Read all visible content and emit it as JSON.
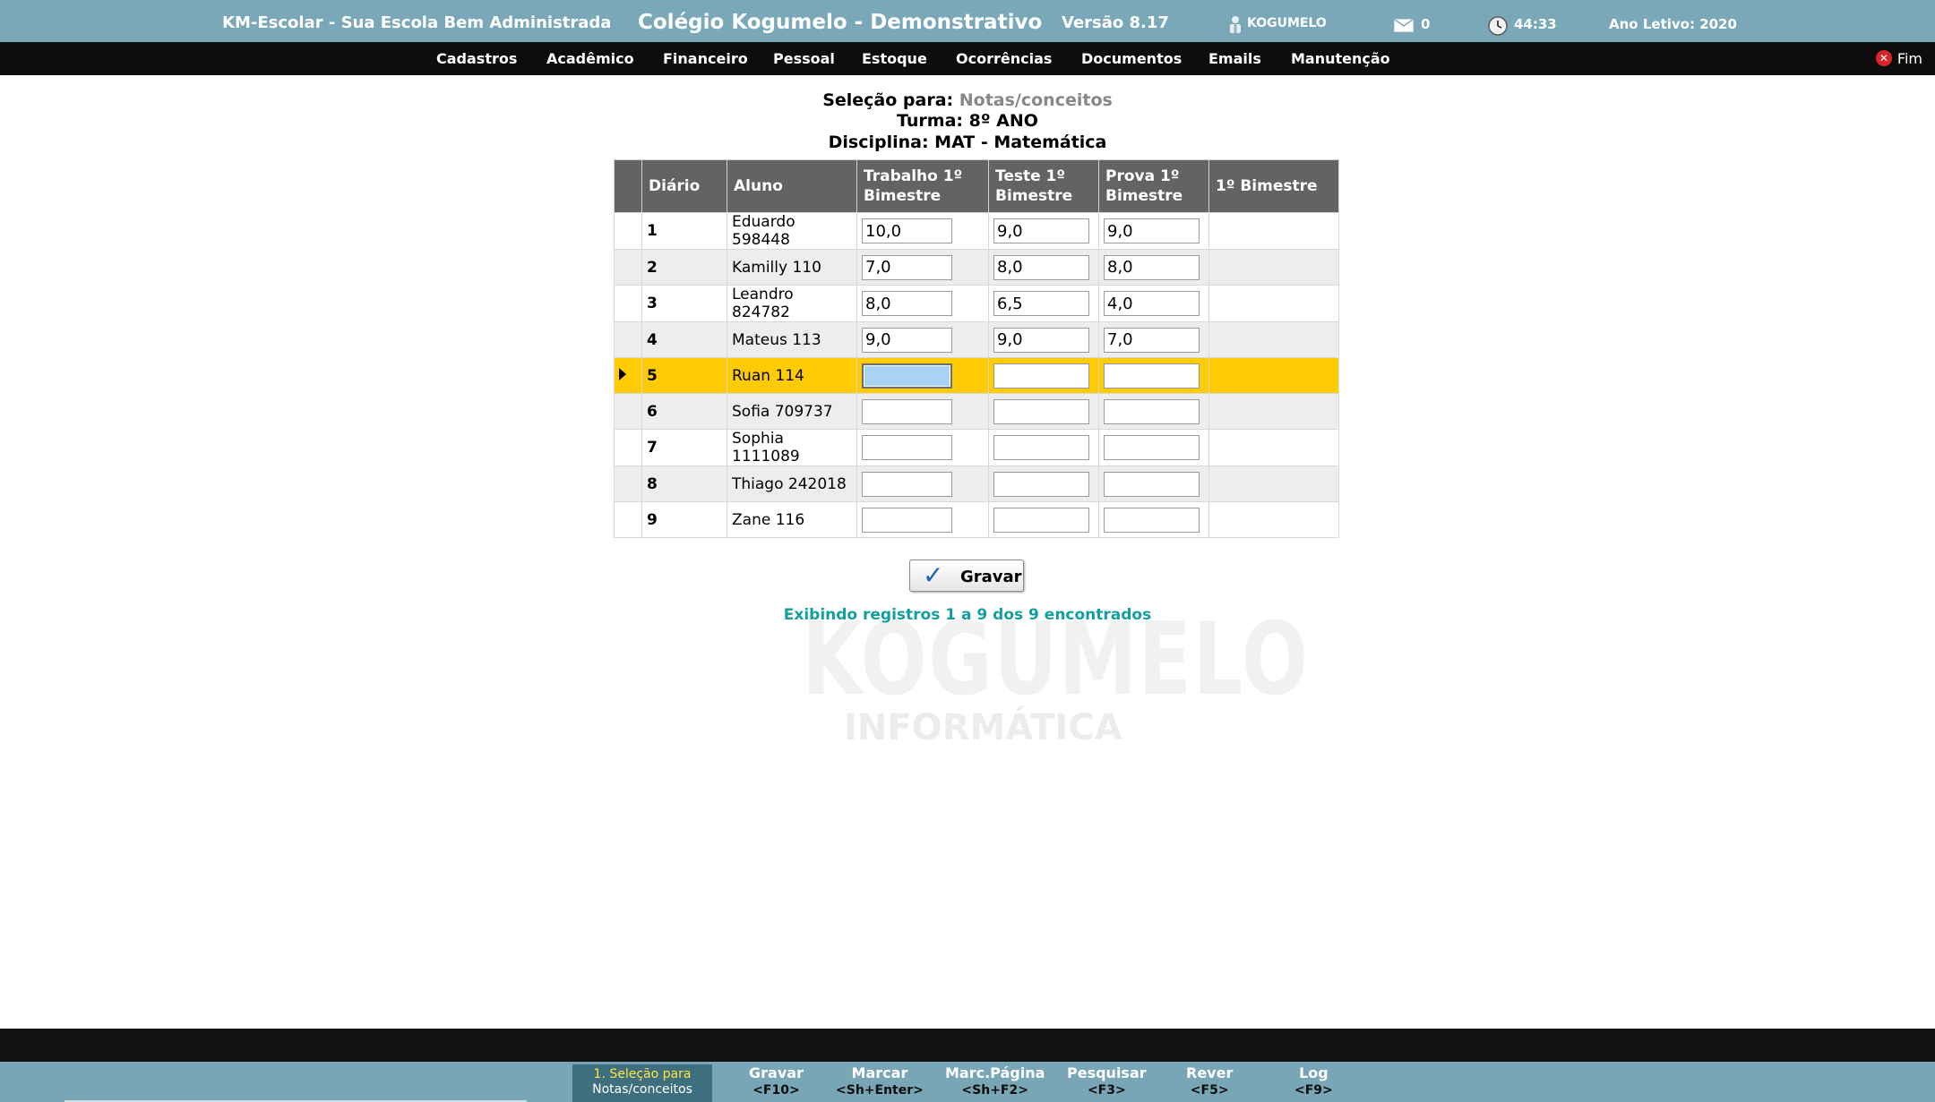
{
  "header": {
    "app_name": "KM-Escolar - Sua Escola Bem Administrada",
    "school": "Colégio Kogumelo - Demonstrativo",
    "version": "Versão 8.17",
    "user": "KOGUMELO",
    "messages": "0",
    "timer": "44:33",
    "school_year": "Ano Letivo: 2020"
  },
  "menu": {
    "items": [
      "Cadastros",
      "Acadêmico",
      "Financeiro",
      "Pessoal",
      "Estoque",
      "Ocorrências",
      "Documentos",
      "Emails",
      "Manutenção"
    ],
    "exit_label": "Fim"
  },
  "watermark": {
    "line1": "KOGUMELO",
    "line2": "INFORMÁTICA"
  },
  "selection": {
    "label": "Seleção para:",
    "value": "Notas/conceitos",
    "turma": "Turma: 8º ANO",
    "disciplina": "Disciplina: MAT - Matemática"
  },
  "table": {
    "headers": [
      "Diário",
      "Aluno",
      "Trabalho 1º Bimestre",
      "Teste 1º Bimestre",
      "Prova 1º Bimestre",
      "1º Bimestre"
    ],
    "selected_row": 5,
    "rows": [
      {
        "num": "1",
        "name": "Eduardo 598448",
        "trabalho": "10,0",
        "teste": "9,0",
        "prova": "9,0",
        "bimestre": ""
      },
      {
        "num": "2",
        "name": "Kamilly 110",
        "trabalho": "7,0",
        "teste": "8,0",
        "prova": "8,0",
        "bimestre": ""
      },
      {
        "num": "3",
        "name": "Leandro 824782",
        "trabalho": "8,0",
        "teste": "6,5",
        "prova": "4,0",
        "bimestre": ""
      },
      {
        "num": "4",
        "name": "Mateus 113",
        "trabalho": "9,0",
        "teste": "9,0",
        "prova": "7,0",
        "bimestre": ""
      },
      {
        "num": "5",
        "name": "Ruan 114",
        "trabalho": "",
        "teste": "",
        "prova": "",
        "bimestre": ""
      },
      {
        "num": "6",
        "name": "Sofia 709737",
        "trabalho": "",
        "teste": "",
        "prova": "",
        "bimestre": ""
      },
      {
        "num": "7",
        "name": "Sophia 1111089",
        "trabalho": "",
        "teste": "",
        "prova": "",
        "bimestre": ""
      },
      {
        "num": "8",
        "name": "Thiago 242018",
        "trabalho": "",
        "teste": "",
        "prova": "",
        "bimestre": ""
      },
      {
        "num": "9",
        "name": "Zane 116",
        "trabalho": "",
        "teste": "",
        "prova": "",
        "bimestre": ""
      }
    ]
  },
  "save_button": "Gravar",
  "records_info": "Exibindo registros 1 a 9 dos 9 encontrados",
  "footer": {
    "active_tab": {
      "line1": "1. Seleção para",
      "line2": "Notas/conceitos"
    },
    "keys": [
      {
        "label": "Gravar",
        "key": "<F10>"
      },
      {
        "label": "Marcar",
        "key": "<Sh+Enter>"
      },
      {
        "label": "Marc.Página",
        "key": "<Sh+F2>"
      },
      {
        "label": "Pesquisar",
        "key": "<F3>"
      },
      {
        "label": "Rever",
        "key": "<F5>"
      },
      {
        "label": "Log",
        "key": "<F9>"
      }
    ]
  },
  "colors": {
    "header_bg": "#7aa8b8",
    "menu_bg": "#0d0d0d",
    "selected_row": "#ffcb05",
    "info_text": "#159e9e"
  }
}
